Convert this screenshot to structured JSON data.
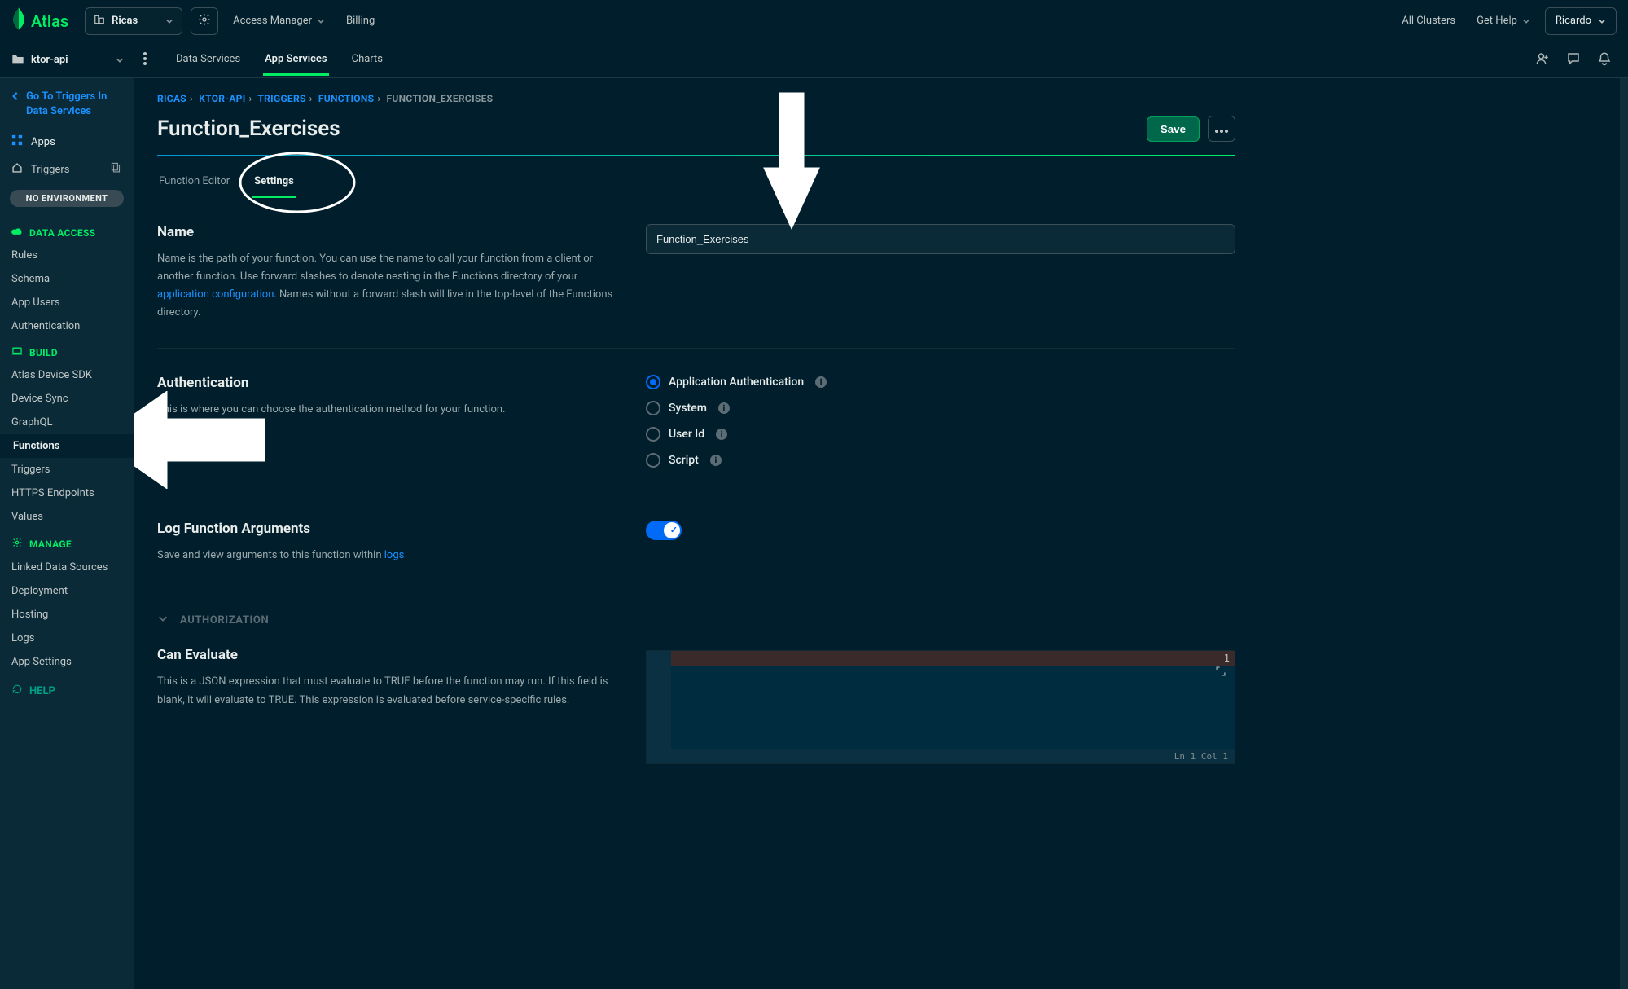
{
  "topbar": {
    "brand": "Atlas",
    "org_name": "Ricas",
    "access_manager": "Access Manager",
    "billing": "Billing",
    "all_clusters": "All Clusters",
    "get_help": "Get Help",
    "user": "Ricardo"
  },
  "secondbar": {
    "project": "ktor-api",
    "tabs": [
      "Data Services",
      "App Services",
      "Charts"
    ],
    "active_tab": 1
  },
  "sidebar": {
    "backlink": "Go To Triggers In Data Services",
    "apps": "Apps",
    "triggers_row": "Triggers",
    "env_pill": "NO ENVIRONMENT",
    "data_access": {
      "heading": "DATA ACCESS",
      "items": [
        "Rules",
        "Schema",
        "App Users",
        "Authentication"
      ]
    },
    "build": {
      "heading": "BUILD",
      "items": [
        "Atlas Device SDK",
        "Device Sync",
        "GraphQL",
        "Functions",
        "Triggers",
        "HTTPS Endpoints",
        "Values"
      ],
      "active": 3
    },
    "manage": {
      "heading": "MANAGE",
      "items": [
        "Linked Data Sources",
        "Deployment",
        "Hosting",
        "Logs",
        "App Settings"
      ]
    },
    "help": "HELP"
  },
  "breadcrumb": {
    "parts": [
      "RICAS",
      "KTOR-API",
      "TRIGGERS",
      "FUNCTIONS"
    ],
    "current": "FUNCTION_EXERCISES"
  },
  "page": {
    "title": "Function_Exercises",
    "save": "Save",
    "tabs": [
      "Function Editor",
      "Settings"
    ],
    "active_tab": 1
  },
  "sections": {
    "name": {
      "heading": "Name",
      "desc1": "Name is the path of your function. You can use the name to call your function from a client or another function. Use forward slashes to denote nesting in the Functions directory of your ",
      "link": "application configuration",
      "desc2": ". Names without a forward slash will live in the top-level of the Functions directory.",
      "value": "Function_Exercises"
    },
    "auth": {
      "heading": "Authentication",
      "desc": "This is where you can choose the authentication method for your function.",
      "options": [
        "Application Authentication",
        "System",
        "User Id",
        "Script"
      ],
      "selected": 0
    },
    "log": {
      "heading": "Log Function Arguments",
      "desc1": "Save and view arguments to this function within ",
      "link": "logs",
      "enabled": true
    },
    "authorization": {
      "heading": "AUTHORIZATION"
    },
    "can_eval": {
      "heading": "Can Evaluate",
      "desc": "This is a JSON expression that must evaluate to TRUE before the function may run. If this field is blank, it will evaluate to TRUE. This expression is evaluated before service-specific rules.",
      "line_no": "1",
      "status": "Ln 1 Col 1"
    }
  }
}
